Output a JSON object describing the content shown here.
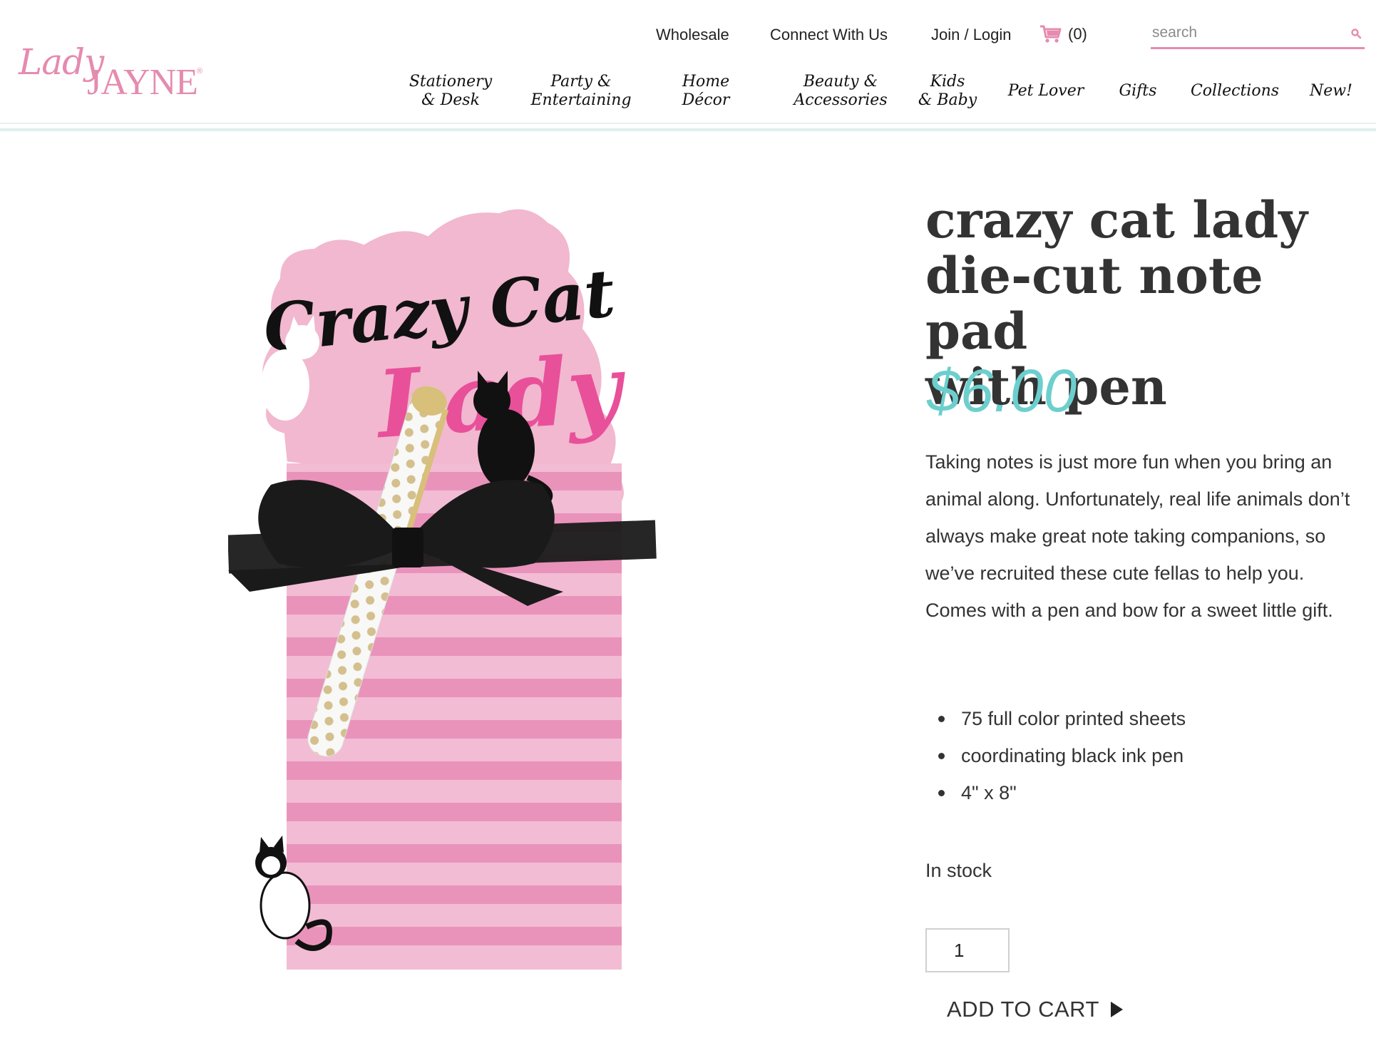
{
  "brand": {
    "logo_script": "Lady",
    "logo_caps": "JAYNE",
    "logo_mark": "®"
  },
  "utility_nav": {
    "wholesale": "Wholesale",
    "connect": "Connect With Us",
    "login": "Join / Login",
    "cart_count": "(0)",
    "search_placeholder": "search"
  },
  "main_nav": [
    "Stationery\n& Desk",
    "Party &\nEntertaining",
    "Home Décor",
    "Beauty &\nAccessories",
    "Kids\n& Baby",
    "Pet Lover",
    "Gifts",
    "Collections",
    "New!"
  ],
  "product": {
    "title_lines": [
      "crazy cat lady",
      "die-cut note pad",
      "with pen"
    ],
    "price": "$6.00",
    "description": "Taking notes is just more fun when you bring an animal along. Unfortunately, real life animals don’t always make great note taking companions, so we’ve recruited these cute fellas to help you. Comes with a pen and bow for a sweet little gift.",
    "features": [
      "75 full color printed sheets",
      "coordinating black ink pen",
      "4\" x 8\""
    ],
    "stock": "In stock",
    "quantity": "1",
    "add_to_cart": "ADD TO CART",
    "image_text": {
      "line1": "Crazy Cat",
      "line2": "Lady"
    }
  },
  "colors": {
    "brand_pink": "#e58bb0",
    "price_teal": "#6ccfcd",
    "nav_rule": "#dff0ec"
  }
}
